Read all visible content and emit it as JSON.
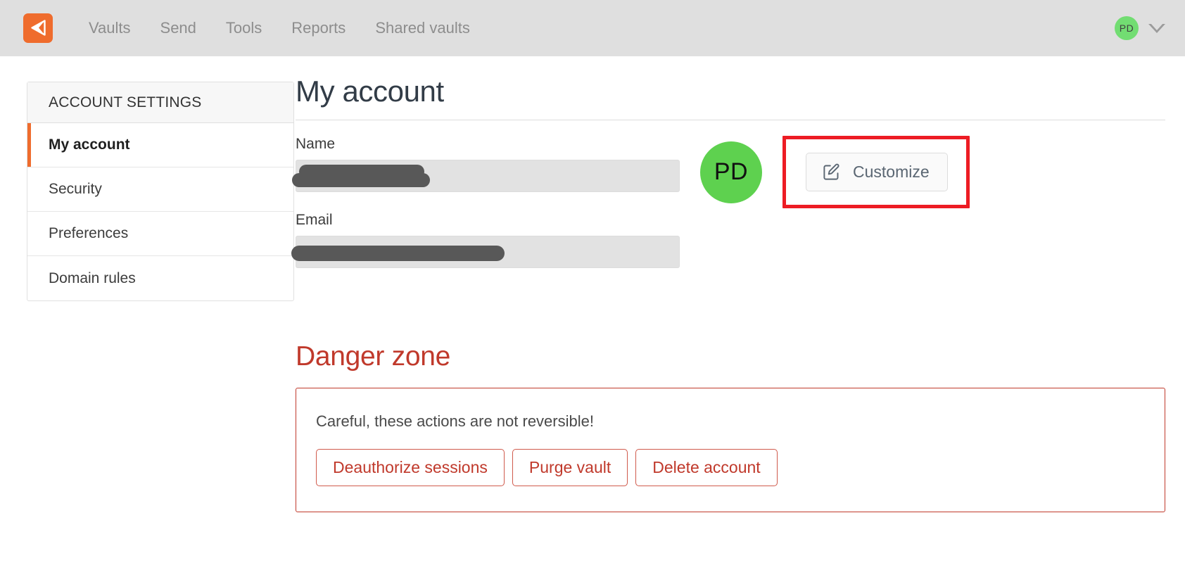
{
  "topbar": {
    "logo_icon": "bitwarden-shield-logo",
    "nav": [
      {
        "label": "Vaults",
        "name": "nav-vaults"
      },
      {
        "label": "Send",
        "name": "nav-send"
      },
      {
        "label": "Tools",
        "name": "nav-tools"
      },
      {
        "label": "Reports",
        "name": "nav-reports"
      },
      {
        "label": "Shared vaults",
        "name": "nav-shared-vaults"
      }
    ],
    "account_avatar_initials": "PD",
    "account_menu_icon": "chevron-down-icon",
    "background_color": "#dfdfdf",
    "avatar_color": "#72dd72"
  },
  "sidebar": {
    "header": "ACCOUNT SETTINGS",
    "active_accent_color": "#ef6c2d",
    "items": [
      {
        "label": "My account",
        "active": true
      },
      {
        "label": "Security",
        "active": false
      },
      {
        "label": "Preferences",
        "active": false
      },
      {
        "label": "Domain rules",
        "active": false
      }
    ]
  },
  "main": {
    "title": "My account",
    "fields": [
      {
        "label": "Name",
        "value": "",
        "redacted": true
      },
      {
        "label": "Email",
        "value": "",
        "redacted": true
      }
    ],
    "profile": {
      "avatar_initials": "PD",
      "avatar_color": "#5ed14f",
      "customize_label": "Customize",
      "customize_icon": "pen-to-square-icon",
      "highlight_color": "#ed1c24"
    },
    "danger_zone": {
      "title": "Danger zone",
      "warning": "Careful, these actions are not reversible!",
      "accent_color": "#c0392b",
      "buttons": [
        {
          "label": "Deauthorize sessions"
        },
        {
          "label": "Purge vault"
        },
        {
          "label": "Delete account"
        }
      ]
    }
  }
}
